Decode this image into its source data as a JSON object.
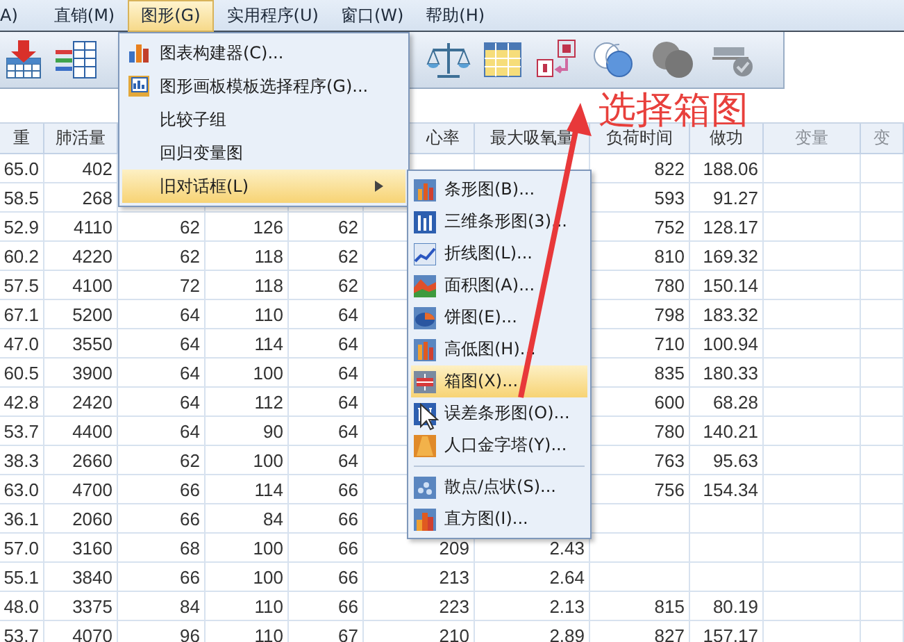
{
  "menubar": [
    {
      "label": "A)",
      "selected": false
    },
    {
      "label": "直销(M)",
      "selected": false
    },
    {
      "label": "图形(G)",
      "selected": true
    },
    {
      "label": "实用程序(U)",
      "selected": false
    },
    {
      "label": "窗口(W)",
      "selected": false
    },
    {
      "label": "帮助(H)",
      "selected": false
    }
  ],
  "table": {
    "columns": [
      "重",
      "肺活量",
      null,
      null,
      null,
      "心率",
      "最大吸氧量",
      "负荷时间",
      "做功",
      "变量",
      "变"
    ],
    "rows": [
      [
        "65.0",
        "402",
        null,
        null,
        null,
        null,
        null,
        "822",
        "188.06"
      ],
      [
        "58.5",
        "268",
        null,
        null,
        null,
        null,
        null,
        "593",
        "91.27"
      ],
      [
        "52.9",
        "4110",
        "62",
        "126",
        "62",
        null,
        null,
        "752",
        "128.17"
      ],
      [
        "60.2",
        "4220",
        "62",
        "118",
        "62",
        null,
        null,
        "810",
        "169.32"
      ],
      [
        "57.5",
        "4100",
        "72",
        "118",
        "62",
        null,
        null,
        "780",
        "150.14"
      ],
      [
        "67.1",
        "5200",
        "64",
        "110",
        "64",
        null,
        null,
        "798",
        "183.32"
      ],
      [
        "47.0",
        "3550",
        "64",
        "114",
        "64",
        null,
        null,
        "710",
        "100.94"
      ],
      [
        "60.5",
        "3900",
        "64",
        "100",
        "64",
        null,
        null,
        "835",
        "180.33"
      ],
      [
        "42.8",
        "2420",
        "64",
        "112",
        "64",
        null,
        null,
        "600",
        "68.28"
      ],
      [
        "53.7",
        "4400",
        "64",
        "90",
        "64",
        null,
        null,
        "780",
        "140.21"
      ],
      [
        "38.3",
        "2660",
        "62",
        "100",
        "64",
        null,
        null,
        "763",
        "95.63"
      ],
      [
        "63.0",
        "4700",
        "66",
        "114",
        "66",
        null,
        null,
        "756",
        "154.34"
      ],
      [
        "36.1",
        "2060",
        "66",
        "84",
        "66",
        null,
        null,
        null,
        null
      ],
      [
        "57.0",
        "3160",
        "68",
        "100",
        "66",
        "209",
        "2.43",
        null,
        null
      ],
      [
        "55.1",
        "3840",
        "66",
        "100",
        "66",
        "213",
        "2.64",
        null,
        null
      ],
      [
        "48.0",
        "3375",
        "84",
        "110",
        "66",
        "223",
        "2.13",
        "815",
        "80.19"
      ],
      [
        "53.7",
        "4070",
        "96",
        "110",
        "67",
        "210",
        "2.89",
        "827",
        "157.17"
      ]
    ]
  },
  "graph_menu": {
    "items": [
      {
        "label": "图表构建器(C)...",
        "selected": false,
        "submenu": false
      },
      {
        "label": "图形画板模板选择程序(G)...",
        "selected": false,
        "submenu": false
      },
      {
        "label": "比较子组",
        "selected": false,
        "submenu": false
      },
      {
        "label": "回归变量图",
        "selected": false,
        "submenu": false
      },
      {
        "label": "旧对话框(L)",
        "selected": true,
        "submenu": true
      }
    ]
  },
  "legacy_dialogs_menu": {
    "groups": [
      [
        {
          "label": "条形图(B)...",
          "selected": false
        },
        {
          "label": "三维条形图(3)...",
          "selected": false
        },
        {
          "label": "折线图(L)...",
          "selected": false
        },
        {
          "label": "面积图(A)...",
          "selected": false
        },
        {
          "label": "饼图(E)...",
          "selected": false
        },
        {
          "label": "高低图(H)...",
          "selected": false
        },
        {
          "label": "箱图(X)...",
          "selected": true
        },
        {
          "label": "误差条形图(O)...",
          "selected": false
        },
        {
          "label": "人口金字塔(Y)...",
          "selected": false
        }
      ],
      [
        {
          "label": "散点/点状(S)...",
          "selected": false
        },
        {
          "label": "直方图(I)...",
          "selected": false
        }
      ]
    ]
  },
  "annotation": {
    "text": "选择箱图"
  }
}
